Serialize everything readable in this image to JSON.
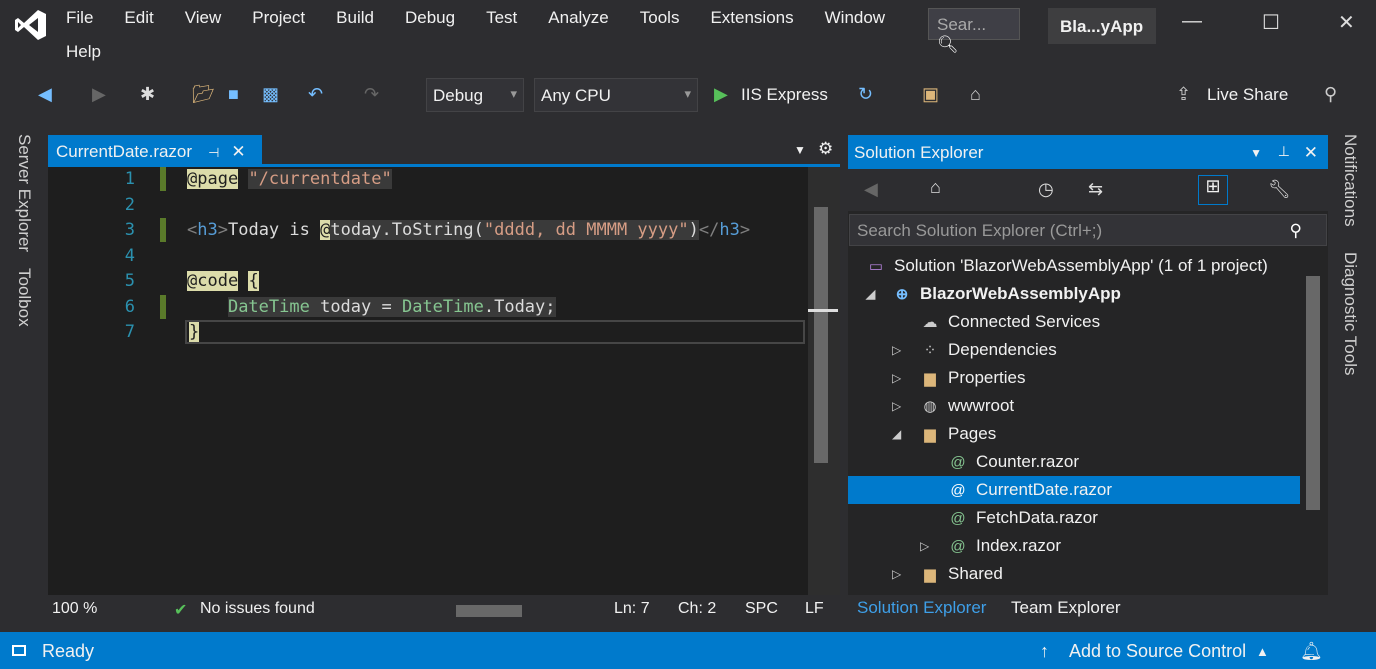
{
  "menu": {
    "items": [
      "File",
      "Edit",
      "View",
      "Project",
      "Build",
      "Debug",
      "Test",
      "Analyze",
      "Tools",
      "Extensions",
      "Window",
      "Help"
    ],
    "search_placeholder": "Sear...",
    "app_title": "Bla...yApp"
  },
  "toolbar": {
    "configuration": "Debug",
    "platform": "Any CPU",
    "run_target": "IIS Express",
    "live_share": "Live Share"
  },
  "left_strip": {
    "tabs": [
      "Server Explorer",
      "Toolbox"
    ]
  },
  "right_strip": {
    "tabs": [
      "Notifications",
      "Diagnostic Tools"
    ]
  },
  "editor": {
    "tab_label": "CurrentDate.razor",
    "line_numbers": [
      "1",
      "2",
      "3",
      "4",
      "5",
      "6",
      "7"
    ],
    "code": {
      "l1a": "@page",
      "l1b": "\"/currentdate\"",
      "l3a": "<",
      "l3b": "h3",
      "l3c": ">",
      "l3d": "Today is ",
      "l3e": "@",
      "l3f": "today.ToString(",
      "l3g": "\"dddd, dd MMMM yyyy\"",
      "l3h": ")",
      "l3i": "</",
      "l3j": "h3",
      "l3k": ">",
      "l5a": "@code",
      "l5b": "{",
      "l6a": "DateTime",
      "l6b": " today = ",
      "l6c": "DateTime",
      "l6d": ".Today;",
      "l7": "}"
    },
    "status": {
      "zoom": "100 %",
      "issues": "No issues found",
      "line": "Ln: 7",
      "col": "Ch: 2",
      "spacing": "SPC",
      "eol": "LF"
    }
  },
  "solution_explorer": {
    "title": "Solution Explorer",
    "search_placeholder": "Search Solution Explorer (Ctrl+;)",
    "items": [
      {
        "label": "Solution 'BlazorWebAssemblyApp' (1 of 1 project)",
        "icon": "solution-icon"
      },
      {
        "label": "BlazorWebAssemblyApp",
        "icon": "project-icon"
      },
      {
        "label": "Connected Services",
        "icon": "cloud-icon"
      },
      {
        "label": "Dependencies",
        "icon": "dependencies-icon"
      },
      {
        "label": "Properties",
        "icon": "folder-icon"
      },
      {
        "label": "wwwroot",
        "icon": "globe-icon"
      },
      {
        "label": "Pages",
        "icon": "folder-open-icon"
      },
      {
        "label": "Counter.razor",
        "icon": "razor-file-icon"
      },
      {
        "label": "CurrentDate.razor",
        "icon": "razor-file-icon"
      },
      {
        "label": "FetchData.razor",
        "icon": "razor-file-icon"
      },
      {
        "label": "Index.razor",
        "icon": "razor-file-icon"
      },
      {
        "label": "Shared",
        "icon": "folder-icon"
      }
    ],
    "tabs": [
      "Solution Explorer",
      "Team Explorer"
    ]
  },
  "statusbar": {
    "state": "Ready",
    "source_control": "Add to Source Control"
  },
  "colors": {
    "accent": "#007acc",
    "background": "#2d2d30",
    "editor": "#1e1e1e"
  }
}
